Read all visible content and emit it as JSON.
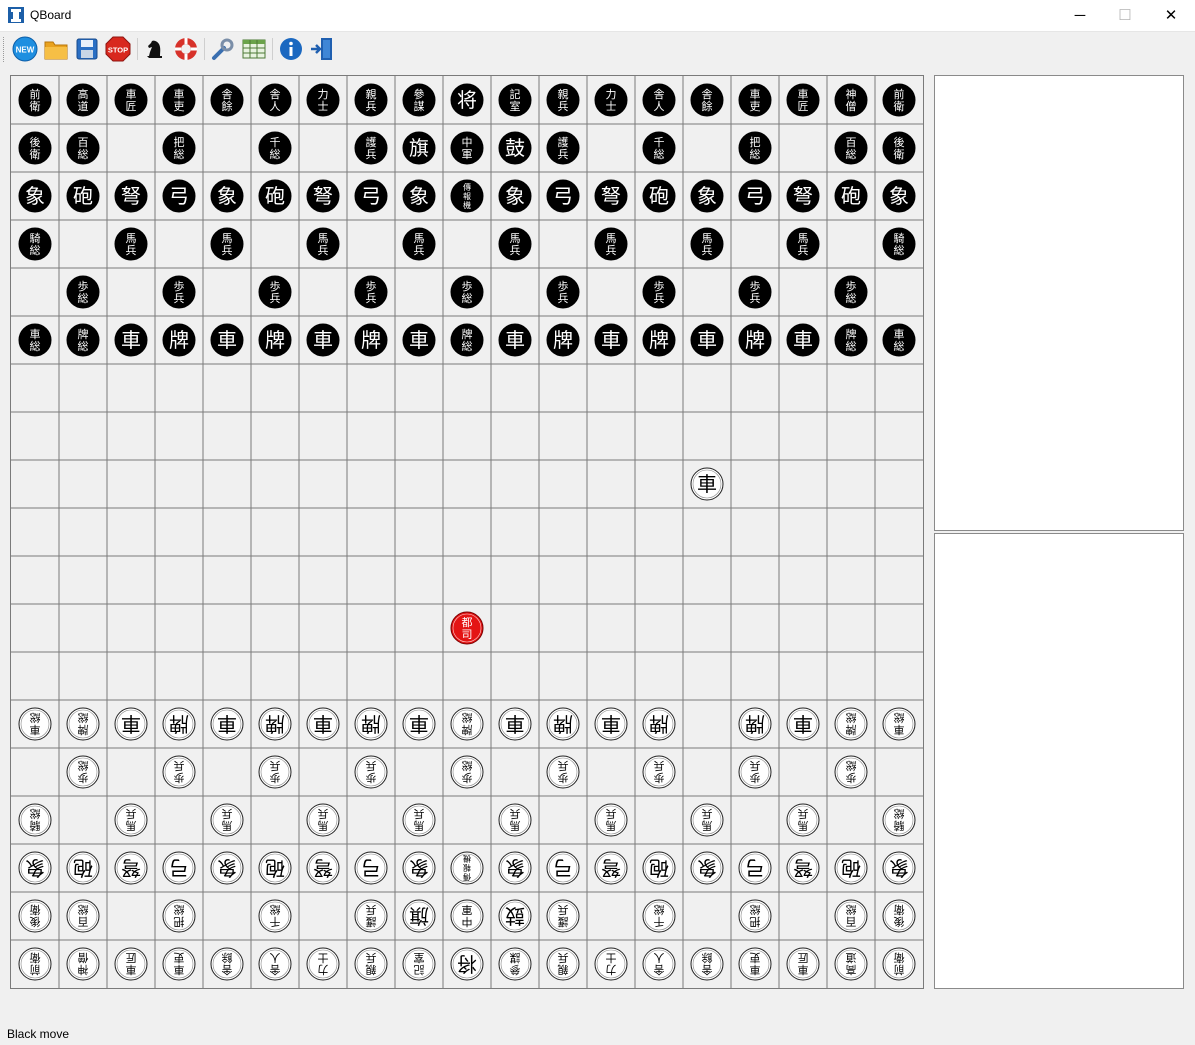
{
  "window": {
    "title": "QBoard",
    "minimize": "─",
    "maximize": "☐",
    "close": "✕"
  },
  "toolbar": [
    {
      "name": "new-game-button",
      "icon": "new-icon",
      "label": "NEW"
    },
    {
      "name": "open-button",
      "icon": "folder-icon"
    },
    {
      "name": "save-button",
      "icon": "floppy-icon"
    },
    {
      "name": "stop-button",
      "icon": "stop-icon",
      "label": "STOP"
    },
    {
      "name": "engine-button",
      "icon": "knight-icon"
    },
    {
      "name": "flip-board-button",
      "icon": "lifebuoy-icon"
    },
    {
      "name": "settings-button",
      "icon": "wrench-icon"
    },
    {
      "name": "table-button",
      "icon": "table-icon"
    },
    {
      "name": "about-button",
      "icon": "info-icon"
    },
    {
      "name": "exit-button",
      "icon": "exit-door-icon"
    }
  ],
  "board": {
    "cols": 19,
    "rows": 19,
    "black_pieces": [
      [
        "前衛",
        "高道",
        "車匠",
        "車吏",
        "舎餘",
        "舎人",
        "力士",
        "親兵",
        "參謀",
        "将",
        "記室",
        "親兵",
        "力士",
        "舎人",
        "舎餘",
        "車吏",
        "車匠",
        "神僧",
        "前衛"
      ],
      [
        "後衛",
        "百総",
        "",
        "把総",
        "",
        "千総",
        "",
        "護兵",
        "旗",
        "中軍",
        "鼓",
        "護兵",
        "",
        "千総",
        "",
        "把総",
        "",
        "百総",
        "後衛"
      ],
      [
        "象",
        "砲",
        "弩",
        "弓",
        "象",
        "砲",
        "弩",
        "弓",
        "象",
        "傳報機",
        "象",
        "弓",
        "弩",
        "砲",
        "象",
        "弓",
        "弩",
        "砲",
        "象"
      ],
      [
        "騎総",
        "",
        "馬兵",
        "",
        "馬兵",
        "",
        "馬兵",
        "",
        "馬兵",
        "",
        "馬兵",
        "",
        "馬兵",
        "",
        "馬兵",
        "",
        "馬兵",
        "",
        "騎総"
      ],
      [
        "",
        "歩総",
        "",
        "歩兵",
        "",
        "歩兵",
        "",
        "歩兵",
        "",
        "歩総",
        "",
        "歩兵",
        "",
        "歩兵",
        "",
        "歩兵",
        "",
        "歩総",
        ""
      ],
      [
        "車総",
        "牌総",
        "車",
        "牌",
        "車",
        "牌",
        "車",
        "牌",
        "車",
        "牌総",
        "車",
        "牌",
        "車",
        "牌",
        "車",
        "牌",
        "車",
        "牌総",
        "車総"
      ]
    ],
    "white_pieces": [
      [
        "車総",
        "牌総",
        "車",
        "牌",
        "車",
        "牌",
        "車",
        "牌",
        "車",
        "牌総",
        "車",
        "牌",
        "車",
        "牌",
        "",
        "牌",
        "車",
        "牌総",
        "車総"
      ],
      [
        "",
        "歩総",
        "",
        "歩兵",
        "",
        "歩兵",
        "",
        "歩兵",
        "",
        "歩総",
        "",
        "歩兵",
        "",
        "歩兵",
        "",
        "歩兵",
        "",
        "歩総",
        ""
      ],
      [
        "騎総",
        "",
        "馬兵",
        "",
        "馬兵",
        "",
        "馬兵",
        "",
        "馬兵",
        "",
        "馬兵",
        "",
        "馬兵",
        "",
        "馬兵",
        "",
        "馬兵",
        "",
        "騎総"
      ],
      [
        "象",
        "砲",
        "弩",
        "弓",
        "象",
        "砲",
        "弩",
        "弓",
        "象",
        "傳報機",
        "象",
        "弓",
        "弩",
        "砲",
        "象",
        "弓",
        "弩",
        "砲",
        "象"
      ],
      [
        "後衛",
        "百総",
        "",
        "把総",
        "",
        "千総",
        "",
        "護兵",
        "旗",
        "中軍",
        "鼓",
        "護兵",
        "",
        "千総",
        "",
        "把総",
        "",
        "百総",
        "後衛"
      ],
      [
        "前衛",
        "神僧",
        "車匠",
        "車吏",
        "舎餘",
        "舎人",
        "力士",
        "親兵",
        "記室",
        "将",
        "參謀",
        "親兵",
        "力士",
        "舎人",
        "舎餘",
        "車吏",
        "車匠",
        "高道",
        "前衛"
      ]
    ],
    "extra_pieces": [
      {
        "row": 8,
        "col": 14,
        "label": "車",
        "side": "white",
        "flipped": false
      },
      {
        "row": 11,
        "col": 9,
        "label": "都司",
        "side": "red",
        "flipped": false
      }
    ],
    "colors": {
      "black": "#000000",
      "white": "#ffffff",
      "red": "#e41414",
      "grid": "#7a7a7a",
      "board": "#f0f0f0"
    }
  },
  "status": {
    "text": "Black move"
  }
}
